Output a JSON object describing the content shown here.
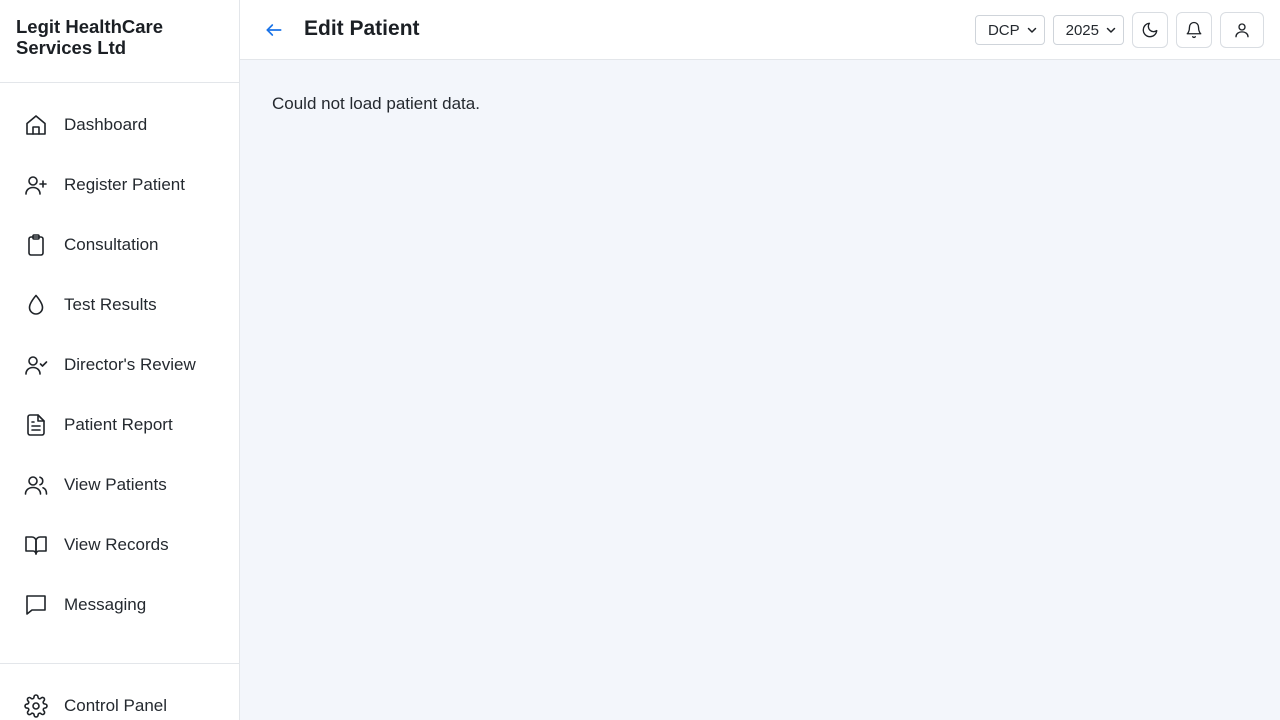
{
  "brand": {
    "name": "Legit HealthCare Services Ltd"
  },
  "sidebar": {
    "items": [
      {
        "label": "Dashboard",
        "icon": "home-icon"
      },
      {
        "label": "Register Patient",
        "icon": "user-plus-icon"
      },
      {
        "label": "Consultation",
        "icon": "clipboard-icon"
      },
      {
        "label": "Test Results",
        "icon": "droplet-icon"
      },
      {
        "label": "Director's Review",
        "icon": "user-check-icon"
      },
      {
        "label": "Patient Report",
        "icon": "file-text-icon"
      },
      {
        "label": "View Patients",
        "icon": "users-icon"
      },
      {
        "label": "View Records",
        "icon": "book-open-icon"
      },
      {
        "label": "Messaging",
        "icon": "message-square-icon"
      }
    ],
    "bottom": {
      "label": "Control Panel",
      "icon": "gear-icon"
    }
  },
  "header": {
    "title": "Edit Patient",
    "back_icon": "arrow-left-icon",
    "site_select": {
      "value": "DCP"
    },
    "year_select": {
      "value": "2025"
    },
    "theme_icon": "moon-icon",
    "notifications_icon": "bell-icon",
    "profile_icon": "user-icon"
  },
  "main": {
    "message": "Could not load patient data."
  },
  "colors": {
    "accent": "#1a73e8",
    "background": "#f3f6fb",
    "sidebar_bg": "#ffffff",
    "border": "#e3e6ea"
  }
}
